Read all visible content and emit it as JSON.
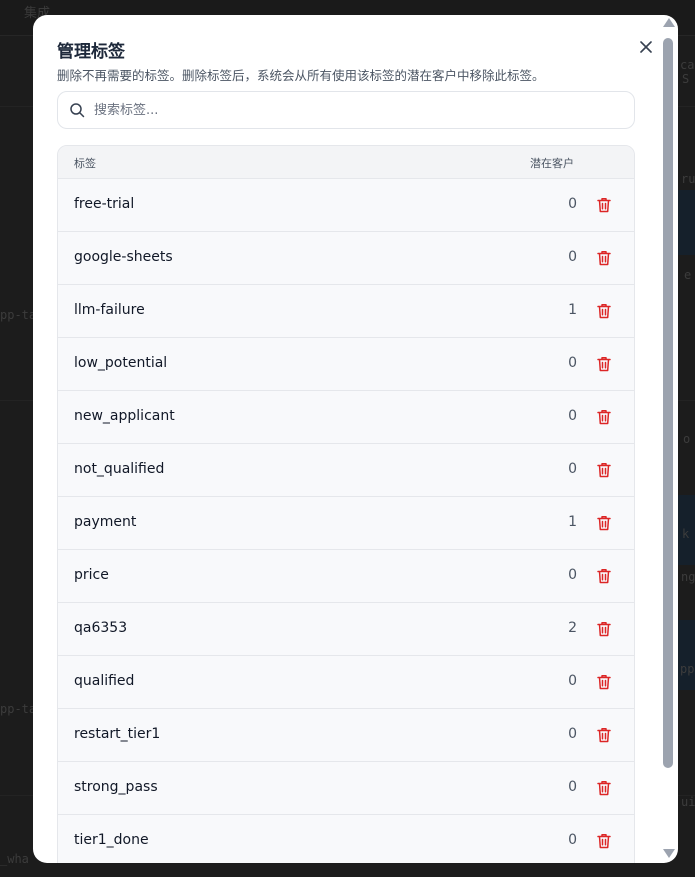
{
  "background": {
    "topbar_title": "集成",
    "fragments": [
      "pp-ta",
      "pp-ta",
      "_wha",
      "ca",
      "S",
      "ru",
      "e",
      "o",
      "k",
      "ng",
      "pp",
      "ui"
    ]
  },
  "modal": {
    "title": "管理标签",
    "subtitle": "删除不再需要的标签。删除标签后，系统会从所有使用该标签的潜在客户中移除此标签。",
    "close_icon": "close-icon",
    "search": {
      "placeholder": "搜索标签...",
      "value": ""
    },
    "table": {
      "headers": {
        "tag": "标签",
        "count": "潜在客户"
      },
      "rows": [
        {
          "name": "free-trial",
          "count": "0"
        },
        {
          "name": "google-sheets",
          "count": "0"
        },
        {
          "name": "llm-failure",
          "count": "1"
        },
        {
          "name": "low_potential",
          "count": "0"
        },
        {
          "name": "new_applicant",
          "count": "0"
        },
        {
          "name": "not_qualified",
          "count": "0"
        },
        {
          "name": "payment",
          "count": "1"
        },
        {
          "name": "price",
          "count": "0"
        },
        {
          "name": "qa6353",
          "count": "2"
        },
        {
          "name": "qualified",
          "count": "0"
        },
        {
          "name": "restart_tier1",
          "count": "0"
        },
        {
          "name": "strong_pass",
          "count": "0"
        },
        {
          "name": "tier1_done",
          "count": "0"
        }
      ]
    }
  },
  "colors": {
    "delete_red": "#dc2626",
    "accent_text": "#1e293b"
  }
}
